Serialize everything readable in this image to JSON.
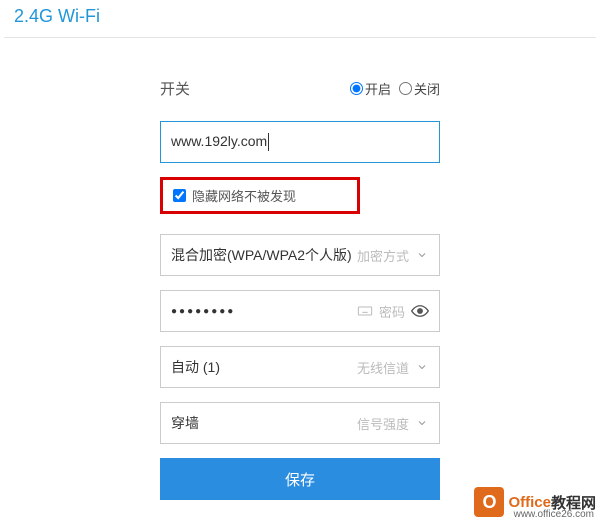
{
  "header": {
    "title": "2.4G Wi-Fi"
  },
  "switch": {
    "label": "开关",
    "on_label": "开启",
    "off_label": "关闭",
    "selected": "on"
  },
  "ssid": {
    "value": "www.192ly.com"
  },
  "hide_network": {
    "label": "隐藏网络不被发现",
    "checked": true
  },
  "encryption": {
    "value": "混合加密(WPA/WPA2个人版)",
    "placeholder": "加密方式"
  },
  "password": {
    "value": "●●●●●●●●",
    "placeholder": "密码"
  },
  "channel": {
    "value": "自动 (1)",
    "placeholder": "无线信道"
  },
  "signal": {
    "value": "穿墙",
    "placeholder": "信号强度"
  },
  "save": {
    "label": "保存"
  },
  "watermark": {
    "brand1": "Office",
    "brand2": "教程网",
    "url": "www.office26.com"
  }
}
